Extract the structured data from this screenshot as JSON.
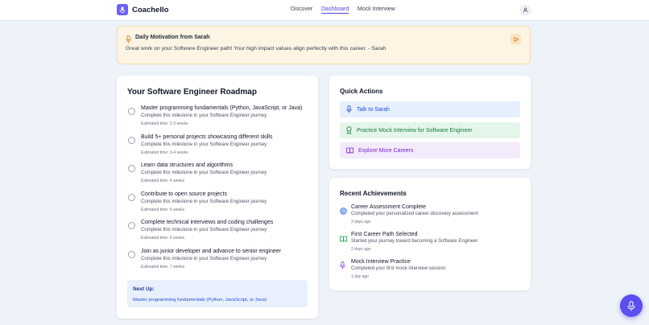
{
  "brand": {
    "name": "Coachello",
    "accent": "#6d5dfc"
  },
  "nav": {
    "links": [
      {
        "label": "Discover",
        "active": false
      },
      {
        "label": "Dashboard",
        "active": true
      },
      {
        "label": "Mock Interview",
        "active": false
      }
    ],
    "avatar_icon": "user-icon"
  },
  "motivation": {
    "icon": "microphone-icon",
    "title": "Daily Motivation from Sarah",
    "message": "Great work on your Software Engineer path! Your high impact values align perfectly with this career. - Sarah",
    "play_icon": "play-icon"
  },
  "roadmap": {
    "title": "Your Software Engineer Roadmap",
    "milestones": [
      {
        "title": "Master programming fundamentals (Python, JavaScript, or Java)",
        "desc": "Complete this milestone in your Software Engineer journey",
        "time": "Estimated time: 2-3 weeks"
      },
      {
        "title": "Build 5+ personal projects showcasing different skills",
        "desc": "Complete this milestone in your Software Engineer journey",
        "time": "Estimated time: 3-4 weeks"
      },
      {
        "title": "Learn data structures and algorithms",
        "desc": "Complete this milestone in your Software Engineer journey",
        "time": "Estimated time: 4 weeks"
      },
      {
        "title": "Contribute to open source projects",
        "desc": "Complete this milestone in your Software Engineer journey",
        "time": "Estimated time: 5 weeks"
      },
      {
        "title": "Complete technical interviews and coding challenges",
        "desc": "Complete this milestone in your Software Engineer journey",
        "time": "Estimated time: 6 weeks"
      },
      {
        "title": "Join as junior developer and advance to senior engineer",
        "desc": "Complete this milestone in your Software Engineer journey",
        "time": "Estimated time: 7 weeks"
      }
    ],
    "next_up": {
      "label": "Next Up:",
      "value": "Master programming fundamentals (Python, JavaScript, or Java)"
    }
  },
  "quick_actions": {
    "title": "Quick Actions",
    "items": [
      {
        "label": "Talk to Sarah",
        "icon": "microphone-icon",
        "bg": "#e6effc",
        "color": "#1d4ed8"
      },
      {
        "label": "Practice Mock Interview for Software Engineer",
        "icon": "award-icon",
        "bg": "#e4f5ea",
        "color": "#15803d"
      },
      {
        "label": "Explore More Careers",
        "icon": "book-icon",
        "bg": "#f3eafc",
        "color": "#7e22ce"
      }
    ]
  },
  "achievements": {
    "title": "Recent Achievements",
    "items": [
      {
        "title": "Career Assessment Complete",
        "desc": "Completed your personalized career discovery assessment",
        "time": "3 days ago",
        "icon": "target-icon"
      },
      {
        "title": "First Career Path Selected",
        "desc": "Started your journey toward becoming a Software Engineer",
        "time": "2 days ago",
        "icon": "book-icon"
      },
      {
        "title": "Mock Interview Practice",
        "desc": "Completed your first mock interview session",
        "time": "1 day ago",
        "icon": "microphone-icon"
      }
    ]
  },
  "fab": {
    "icon": "microphone-icon"
  }
}
